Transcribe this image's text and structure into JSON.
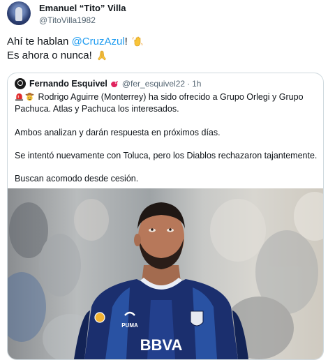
{
  "author": {
    "name": "Emanuel “Tito” Villa",
    "handle": "@TitoVilla1982"
  },
  "tweet": {
    "line1_prefix": "Ahí te hablan ",
    "line1_mention": "@CruzAzul",
    "line1_suffix": "!",
    "line1_emoji": "waving-hand-icon",
    "line2_text": "Es ahora o nunca! ",
    "line2_emoji": "folded-hands-icon"
  },
  "quote": {
    "name": "Fernando Esquivel",
    "badge_icon": "red-bird-icon",
    "handle": "@fer_esquivel22",
    "separator": "·",
    "time": "1h",
    "p1_icons": [
      "red-siren-icon",
      "cowboy-face-icon"
    ],
    "p1": "Rodrigo Aguirre (Monterrey) ha sido ofrecido a Grupo Orlegi y Grupo Pachuca. Atlas y Pachuca los interesados.",
    "p2": "Ambos analizan y darán respuesta en próximos días.",
    "p3": "Se intentó nuevamente con Toluca, pero los Diablos rechazaron tajantemente.",
    "p4": "Buscan acomodo desde cesión.",
    "photo": {
      "jersey_sponsor": "BBVA",
      "jersey_brand": "PUMA",
      "colors": {
        "jersey": "#1b2f6e",
        "jersey_light": "#3a6bc4"
      }
    }
  }
}
